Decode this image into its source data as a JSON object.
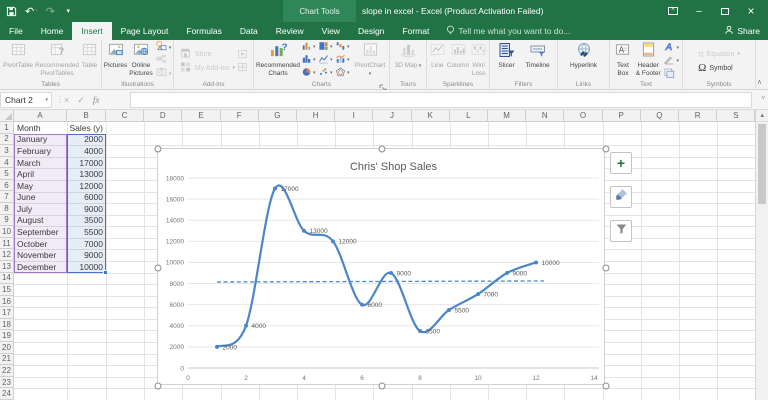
{
  "titlebar": {
    "contextual_label": "Chart Tools",
    "title": "slope in excel - Excel (Product Activation Failed)"
  },
  "tabs": {
    "items": [
      "File",
      "Home",
      "Insert",
      "Page Layout",
      "Formulas",
      "Data",
      "Review",
      "View",
      "Design",
      "Format"
    ],
    "active": "Insert",
    "tell_me": "Tell me what you want to do...",
    "share_label": "Share"
  },
  "ribbon": {
    "groups": [
      {
        "label": "Tables",
        "blocks": [
          {
            "kind": "large",
            "label": "PivotTable",
            "icon": "pivottable-icon",
            "enabled": false
          },
          {
            "kind": "large",
            "label": "Recommended PivotTables",
            "icon": "recommended-pivottables-icon",
            "enabled": false,
            "w": 44
          },
          {
            "kind": "large",
            "label": "Table",
            "icon": "table-icon",
            "enabled": false,
            "w": 26
          }
        ]
      },
      {
        "label": "Illustrations",
        "blocks": [
          {
            "kind": "large",
            "label": "Pictures",
            "icon": "pictures-icon",
            "enabled": true,
            "w": 30
          },
          {
            "kind": "large",
            "label": "Online Pictures",
            "icon": "online-pictures-icon",
            "enabled": true,
            "w": 32
          },
          {
            "kind": "ministack",
            "items": [
              {
                "icon": "shapes-icon",
                "caret": true,
                "enabled": true
              },
              {
                "icon": "smartart-icon",
                "caret": false,
                "enabled": false
              },
              {
                "icon": "screenshot-icon",
                "caret": true,
                "enabled": false
              }
            ]
          }
        ]
      },
      {
        "label": "Add-ins",
        "blocks": [
          {
            "kind": "smallstack",
            "items": [
              {
                "label": "Store",
                "icon": "store-icon",
                "caret": false,
                "enabled": false
              },
              {
                "label": "My Add-ins",
                "icon": "my-addins-icon",
                "caret": true,
                "enabled": false
              }
            ]
          },
          {
            "kind": "ministack",
            "items": [
              {
                "icon": "addin-panel-icon",
                "caret": false,
                "enabled": false
              },
              {
                "icon": "addin-grid-icon",
                "caret": false,
                "enabled": false
              }
            ]
          }
        ]
      },
      {
        "label": "Charts",
        "launcher": true,
        "blocks": [
          {
            "kind": "large",
            "label": "Recommended Charts",
            "icon": "recommended-charts-icon",
            "enabled": true,
            "w": 42
          },
          {
            "kind": "minigrid",
            "items": [
              {
                "icon": "column-chart-icon"
              },
              {
                "icon": "hierarchy-chart-icon"
              },
              {
                "icon": "waterfall-chart-icon"
              },
              {
                "icon": "statistic-chart-icon"
              },
              {
                "icon": "line-chart-icon"
              },
              {
                "icon": "combo-chart-icon"
              },
              {
                "icon": "pie-chart-icon"
              },
              {
                "icon": "scatter-chart-icon"
              },
              {
                "icon": "radar-chart-icon"
              }
            ]
          },
          {
            "kind": "large",
            "label": "PivotChart",
            "icon": "pivotchart-icon",
            "enabled": false,
            "caret": true
          }
        ]
      },
      {
        "label": "Tours",
        "blocks": [
          {
            "kind": "large",
            "label": "3D Map",
            "icon": "map3d-icon",
            "enabled": false,
            "caret": true,
            "w": 28
          }
        ]
      },
      {
        "label": "Sparklines",
        "blocks": [
          {
            "kind": "large",
            "label": "Line",
            "icon": "sparkline-line-icon",
            "enabled": false,
            "w": 20
          },
          {
            "kind": "large",
            "label": "Column",
            "icon": "sparkline-column-icon",
            "enabled": false,
            "w": 26
          },
          {
            "kind": "large",
            "label": "Win/ Loss",
            "icon": "winloss-icon",
            "enabled": false,
            "w": 20
          }
        ]
      },
      {
        "label": "Filters",
        "blocks": [
          {
            "kind": "large",
            "label": "Slicer",
            "icon": "slicer-icon",
            "enabled": true,
            "w": 26
          },
          {
            "kind": "large",
            "label": "Timeline",
            "icon": "timeline-icon",
            "enabled": true,
            "w": 32
          }
        ]
      },
      {
        "label": "Links",
        "blocks": [
          {
            "kind": "large",
            "label": "Hyperlink",
            "icon": "hyperlink-icon",
            "enabled": true,
            "w": 38
          }
        ]
      },
      {
        "label": "Text",
        "blocks": [
          {
            "kind": "large",
            "label": "Text Box",
            "icon": "textbox-icon",
            "enabled": true,
            "w": 24
          },
          {
            "kind": "large",
            "label": "Header & Footer",
            "icon": "header-footer-icon",
            "enabled": true,
            "w": 32
          },
          {
            "kind": "ministack",
            "items": [
              {
                "icon": "wordart-icon",
                "caret": true,
                "enabled": true
              },
              {
                "icon": "signature-line-icon",
                "caret": true,
                "enabled": true
              },
              {
                "icon": "object-icon",
                "caret": false,
                "enabled": true
              }
            ]
          }
        ]
      },
      {
        "label": "Symbols",
        "blocks": [
          {
            "kind": "smallstack",
            "items": [
              {
                "label": "Equation",
                "icon": "equation-icon",
                "caret": true,
                "enabled": false
              },
              {
                "label": "Symbol",
                "icon": "symbol-icon",
                "caret": false,
                "enabled": true
              }
            ]
          }
        ]
      }
    ]
  },
  "formula_bar": {
    "name_box": "Chart 2",
    "formula_value": ""
  },
  "sheet": {
    "columns": [
      "A",
      "B",
      "C",
      "D",
      "E",
      "F",
      "G",
      "H",
      "I",
      "J",
      "K",
      "L",
      "M",
      "N",
      "O",
      "P",
      "Q",
      "R",
      "S"
    ],
    "rows": [
      1,
      2,
      3,
      4,
      5,
      6,
      7,
      8,
      9,
      10,
      11,
      12,
      13,
      14,
      15,
      16,
      17,
      18,
      19,
      20,
      21,
      22,
      23,
      24
    ]
  },
  "table": {
    "headers": [
      "Month",
      "Sales (y)"
    ],
    "rows": [
      [
        "January",
        "2000"
      ],
      [
        "February",
        "4000"
      ],
      [
        "March",
        "17000"
      ],
      [
        "April",
        "13000"
      ],
      [
        "May",
        "12000"
      ],
      [
        "June",
        "6000"
      ],
      [
        "July",
        "9000"
      ],
      [
        "August",
        "3500"
      ],
      [
        "September",
        "5500"
      ],
      [
        "October",
        "7000"
      ],
      [
        "November",
        "9000"
      ],
      [
        "December",
        "10000"
      ]
    ]
  },
  "chart_data": {
    "type": "line",
    "smoothed": true,
    "title": "Chris' Shop Sales",
    "x": [
      1,
      2,
      3,
      4,
      5,
      6,
      7,
      8,
      9,
      10,
      11,
      12
    ],
    "categories": [
      "January",
      "February",
      "March",
      "April",
      "May",
      "June",
      "July",
      "August",
      "September",
      "October",
      "November",
      "December"
    ],
    "series": [
      {
        "name": "Sales (y)",
        "color": "#4a86c8",
        "values": [
          2000,
          4000,
          17000,
          13000,
          12000,
          6000,
          9000,
          3500,
          5500,
          7000,
          9000,
          10000
        ]
      }
    ],
    "data_labels": [
      "2000",
      "4000",
      "17000",
      "13000",
      "12000",
      "6000",
      "9000",
      "3500",
      "5500",
      "7000",
      "9000",
      "10000"
    ],
    "trendline": {
      "style": "dashed",
      "color": "#4a86c8",
      "y_value": 8150,
      "x_start": 1,
      "x_end": 12
    },
    "xlim": [
      0,
      14
    ],
    "x_ticks": [
      0,
      2,
      4,
      6,
      8,
      10,
      12,
      14
    ],
    "ylim": [
      0,
      18000
    ],
    "y_tick_step": 2000,
    "legend": "none",
    "gridlines": "horizontal"
  },
  "colors": {
    "excel_green": "#217346",
    "chart_line_blue": "#4a86c8",
    "category_highlight_border": "#9c7bc8",
    "value_highlight_border": "#4472c4"
  }
}
